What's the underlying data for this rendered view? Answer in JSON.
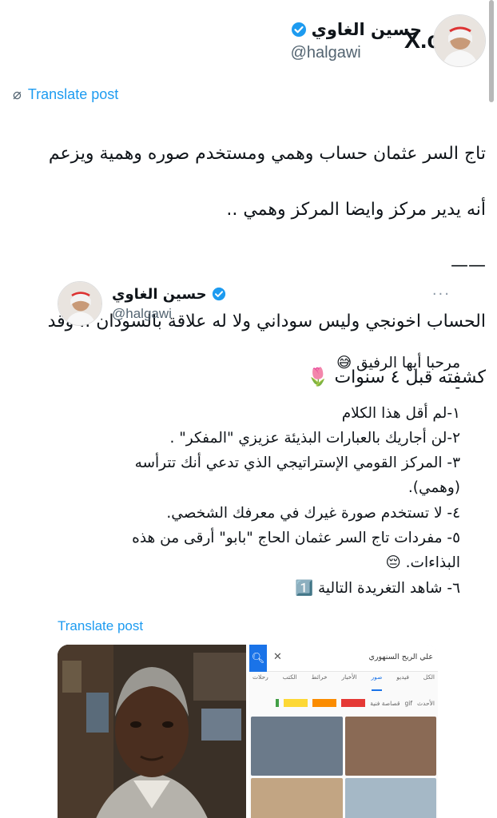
{
  "brand": {
    "logo": "X",
    "suffix": ".com"
  },
  "author": {
    "name": "حسين الغاوي",
    "handle": "@halgawi",
    "verified": true
  },
  "translate_label": "Translate post",
  "post_lines": [
    "تاج السر عثمان حساب وهمي ومستخدم صوره وهمية ويزعم",
    "أنه يدير مركز وايضا المركز وهمي ..",
    "——",
    "الحساب اخونجي وليس سوداني ولا له علاقة بالسودان .. وقد",
    "كشفته قبل ٤ سنوات 🌷"
  ],
  "quote": {
    "name": "حسين الغاوي",
    "handle": "@halgawi",
    "more": "···",
    "lines": [
      "مرحبا أيها الرفيق 😅",
      "-",
      "١-لم أقل هذا الكلام",
      "٢-لن أجاريك بالعبارات البذيئة عزيزي \"المفكر\" .",
      "٣- المركز القومي الإستراتيجي الذي تدعي أنك تترأسه",
      "(وهمي).",
      "٤- لا تستخدم صورة غيرك في معرفك الشخصي.",
      "٥- مفردات تاج السر عثمان الحاج \"بابو\" أرقى من هذه",
      "البذاءات. 😔",
      "٦- شاهد التغريدة التالية 1️⃣"
    ],
    "translate_label": "Translate post"
  },
  "search_shot": {
    "query": "علي الريح السنهوري",
    "tabs": [
      "الكل",
      "فيديو",
      "صور",
      "الأخبار",
      "خرائط",
      "الكتب",
      "رحلات"
    ],
    "active_tab": "صور",
    "filters": [
      "الأحدث",
      "gif",
      "قصاصة فنية"
    ],
    "swatch_colors": [
      "#e53935",
      "#fb8c00",
      "#fdd835",
      "#43a047"
    ]
  },
  "colors": {
    "link": "#1d9bf0",
    "verified": "#1d9bf0",
    "muted": "#536471"
  }
}
